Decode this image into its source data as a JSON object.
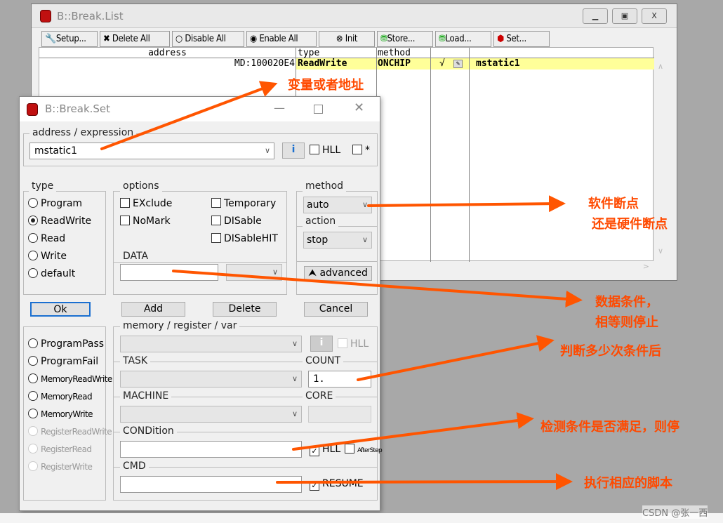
{
  "break_list": {
    "title": "B::Break.List",
    "window_buttons": [
      "minimize",
      "maximize",
      "close"
    ],
    "toolbar": [
      "Setup...",
      "Delete All",
      "Disable All",
      "Enable All",
      "Init",
      "Store...",
      "Load...",
      "Set..."
    ],
    "columns": [
      "address",
      "type",
      "method",
      "",
      ""
    ],
    "rows": [
      {
        "address": "MD:100020E4",
        "type": "ReadWrite",
        "method": "ONCHIP",
        "enabled": "√",
        "name": "mstatic1"
      }
    ]
  },
  "break_set": {
    "title": "B::Break.Set",
    "address_label": "address / expression",
    "address_value": "mstatic1",
    "hll_label": "HLL",
    "star_label": "*",
    "type_label": "type",
    "types": [
      "Program",
      "ReadWrite",
      "Read",
      "Write",
      "default"
    ],
    "type_selected": "ReadWrite",
    "options_label": "options",
    "options": [
      "EXclude",
      "NoMark",
      "Temporary",
      "DISable",
      "DISableHIT"
    ],
    "method_label": "method",
    "method_value": "auto",
    "action_label": "action",
    "action_value": "stop",
    "data_label": "DATA",
    "data_value": "",
    "advanced_label": "advanced",
    "buttons": [
      "Ok",
      "Add",
      "Delete",
      "Cancel"
    ],
    "subtypes": [
      "ProgramPass",
      "ProgramFail",
      "MemoryReadWrite",
      "MemoryRead",
      "MemoryWrite",
      "RegisterReadWrite",
      "RegisterRead",
      "RegisterWrite"
    ],
    "mrv_label": "memory / register / var",
    "mrv_hll": "HLL",
    "task_label": "TASK",
    "count_label": "COUNT",
    "count_value": "1.",
    "machine_label": "MACHINE",
    "core_label": "CORE",
    "condition_label": "CONDition",
    "cond_hll": "HLL",
    "afterstep": "AfterStep",
    "cmd_label": "CMD",
    "resume": "RESUME"
  },
  "annotations": {
    "a1": "变量或者地址",
    "a2a": "软件断点",
    "a2b": "还是硬件断点",
    "a3a": "数据条件，",
    "a3b": "相等则停止",
    "a4": "判断多少次条件后",
    "a5": "检测条件是否满足，则停",
    "a6": "执行相应的脚本",
    "color": "#ff5500"
  },
  "watermark": "CSDN @张一西"
}
